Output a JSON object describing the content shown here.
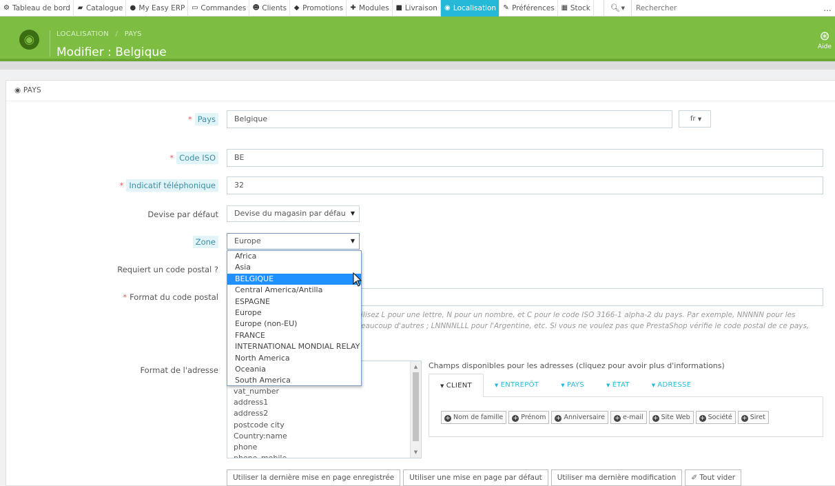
{
  "nav": {
    "items": [
      {
        "label": "Tableau de bord",
        "icon": "dashboard-icon",
        "glyph": "⚙"
      },
      {
        "label": "Catalogue",
        "icon": "book-icon",
        "glyph": "▰"
      },
      {
        "label": "My Easy ERP",
        "icon": "erp-logo-icon",
        "glyph": "●"
      },
      {
        "label": "Commandes",
        "icon": "credit-card-icon",
        "glyph": "▭"
      },
      {
        "label": "Clients",
        "icon": "users-icon",
        "glyph": "☻"
      },
      {
        "label": "Promotions",
        "icon": "tag-icon",
        "glyph": "◆"
      },
      {
        "label": "Modules",
        "icon": "puzzle-icon",
        "glyph": "✚"
      },
      {
        "label": "Livraison",
        "icon": "truck-icon",
        "glyph": "■"
      },
      {
        "label": "Localisation",
        "icon": "globe-icon",
        "glyph": "◉",
        "active": true
      },
      {
        "label": "Préférences",
        "icon": "wrench-icon",
        "glyph": "✎"
      },
      {
        "label": "Stock",
        "icon": "stock-icon",
        "glyph": "▦"
      }
    ],
    "search_placeholder": "Rechercher",
    "more": "..."
  },
  "header": {
    "breadcrumb_section": "LOCALISATION",
    "breadcrumb_sep": "/",
    "breadcrumb_page": "PAYS",
    "title": "Modifier : Belgique",
    "help_label": "Aide"
  },
  "panel": {
    "heading": "PAYS"
  },
  "form": {
    "country_label": "Pays",
    "country_value": "Belgique",
    "lang": "fr",
    "iso_label": "Code ISO",
    "iso_value": "BE",
    "phone_label": "Indicatif téléphonique",
    "phone_value": "32",
    "currency_label": "Devise par défaut",
    "currency_value": "Devise du magasin par défau",
    "zone_label": "Zone",
    "zone_value": "Europe",
    "zip_required_label": "Requiert un code postal ?",
    "zip_format_label": "Format du code postal",
    "help_line1": "ilisez L pour une lettre, N pour un nombre, et C pour le code ISO 3166-1 alpha-2 du pays. Par exemple, NNNNN pour les",
    "help_line2": "eaucoup d'autres ; LNNNNLLL pour l'Argentine, etc. Si vous ne voulez pas que PrestaShop vérifie le code postal de ce pays,",
    "address_label": "Format de l'adresse"
  },
  "zone_options": [
    "Africa",
    "Asia",
    "BELGIQUE",
    "Central America/Antilla",
    "ESPAGNE",
    "Europe",
    "Europe (non-EU)",
    "FRANCE",
    "INTERNATIONAL MONDIAL RELAY",
    "North America",
    "Oceania",
    "South America"
  ],
  "zone_highlighted": "BELGIQUE",
  "address_lines": [
    "vat_number",
    "address1",
    "address2",
    "postcode city",
    "Country:name",
    "phone",
    "phone_mobile"
  ],
  "fields": {
    "title": "Champs disponibles pour les adresses (cliquez pour avoir plus d'informations)",
    "tabs": [
      "CLIENT",
      "ENTREPÔT",
      "PAYS",
      "ÉTAT",
      "ADRESSE"
    ],
    "chips": [
      "Nom de famille",
      "Prénom",
      "Anniversaire",
      "e-mail",
      "Site Web",
      "Société",
      "Siret"
    ]
  },
  "buttons": {
    "last_saved": "Utiliser la dernière mise en page enregistrée",
    "default_layout": "Utiliser une mise en page par défaut",
    "last_change": "Utiliser ma dernière modification",
    "clear_all": "Tout vider"
  },
  "colors": {
    "header_green": "#7cbd42",
    "accent_blue": "#25b9d7",
    "highlight": "#1e90ff"
  }
}
